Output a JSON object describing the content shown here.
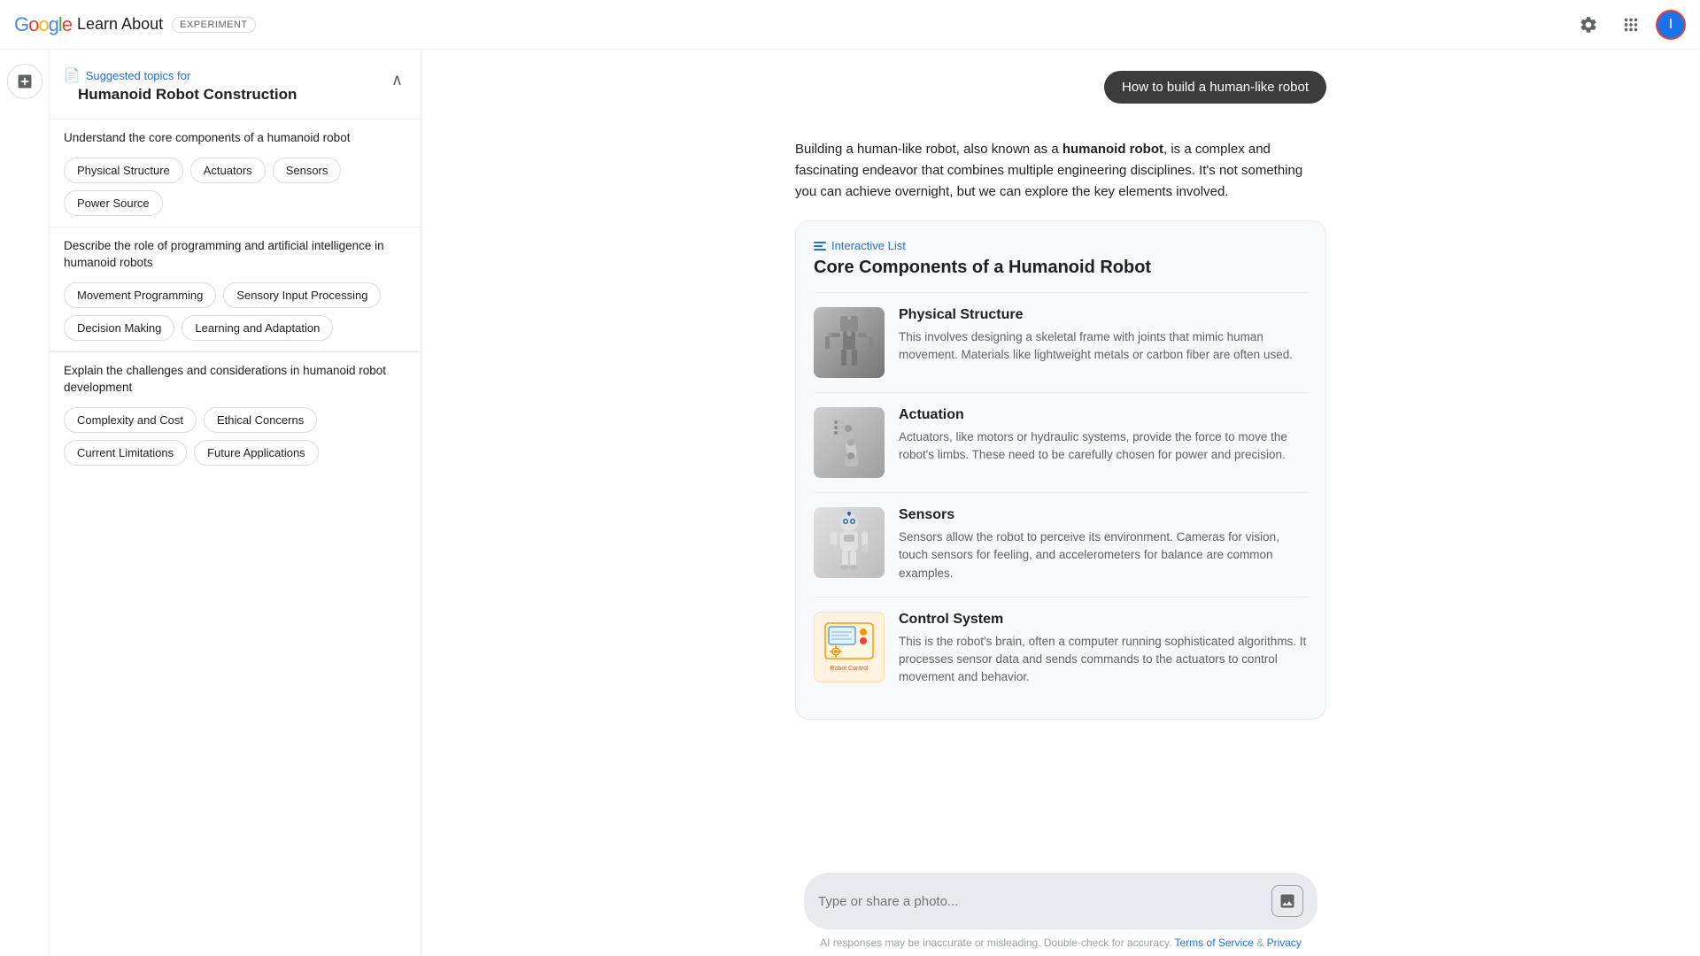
{
  "header": {
    "google_logo": "Google",
    "learn_about": "Learn About",
    "experiment_badge": "EXPERIMENT",
    "settings_icon": "settings",
    "apps_icon": "apps",
    "avatar_letter": "I"
  },
  "sidebar": {
    "suggested_label": "Suggested topics for",
    "topic_title": "Humanoid Robot Construction",
    "sections": [
      {
        "id": "section1",
        "heading": "Understand the core components of a humanoid robot",
        "chips": [
          "Physical Structure",
          "Actuators",
          "Sensors",
          "Power Source"
        ]
      },
      {
        "id": "section2",
        "heading": "Describe the role of programming and artificial intelligence in humanoid robots",
        "chips": [
          "Movement Programming",
          "Sensory Input Processing",
          "Decision Making",
          "Learning and Adaptation"
        ]
      },
      {
        "id": "section3",
        "heading": "Explain the challenges and considerations in humanoid robot development",
        "chips": [
          "Complexity and Cost",
          "Ethical Concerns",
          "Current Limitations",
          "Future Applications"
        ]
      }
    ]
  },
  "query_badge": "How to build a human-like robot",
  "intro_text_before": "Building a human-like robot, also known as a ",
  "intro_text_bold": "humanoid robot",
  "intro_text_after": ", is a complex and fascinating endeavor that combines multiple engineering disciplines. It's not something you can achieve overnight, but we can explore the key elements involved.",
  "card": {
    "label": "Interactive List",
    "title": "Core Components of a Humanoid Robot",
    "items": [
      {
        "id": "physical-structure",
        "title": "Physical Structure",
        "desc": "This involves designing a skeletal frame with joints that mimic human movement. Materials like lightweight metals or carbon fiber are often used."
      },
      {
        "id": "actuation",
        "title": "Actuation",
        "desc": "Actuators, like motors or hydraulic systems, provide the force to move the robot's limbs. These need to be carefully chosen for power and precision."
      },
      {
        "id": "sensors",
        "title": "Sensors",
        "desc": "Sensors allow the robot to perceive its environment. Cameras for vision, touch sensors for feeling, and accelerometers for balance are common examples."
      },
      {
        "id": "control-system",
        "title": "Control System",
        "desc": "This is the robot's brain, often a computer running sophisticated algorithms. It processes sensor data and sends commands to the actuators to control movement and behavior."
      }
    ]
  },
  "input": {
    "placeholder": "Type or share a photo...",
    "image_icon": "image"
  },
  "footer": {
    "text": "AI responses may be inaccurate or misleading. Double-check for accuracy.",
    "terms_label": "Terms of Service",
    "terms_url": "#",
    "and": "&",
    "privacy_label": "Privacy",
    "privacy_url": "#"
  }
}
